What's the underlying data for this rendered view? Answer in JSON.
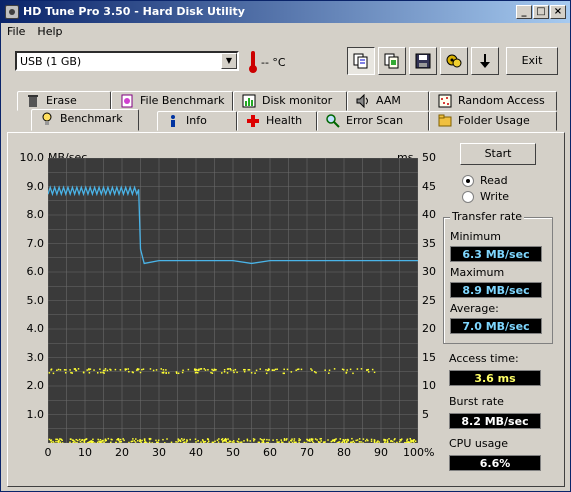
{
  "window": {
    "title": "HD Tune Pro 3.50 - Hard Disk Utility",
    "minimize": "_",
    "maximize": "□",
    "close": "×"
  },
  "menu": {
    "file": "File",
    "help": "Help"
  },
  "toolbar": {
    "drive": "USB (1 GB)",
    "temperature": "-- °C",
    "exit_label": "Exit",
    "icons": [
      "copy-text-icon",
      "copy-screenshot-icon",
      "save-icon",
      "options-icon",
      "download-icon"
    ]
  },
  "tabs_top": [
    "Erase",
    "File Benchmark",
    "Disk monitor",
    "AAM",
    "Random Access"
  ],
  "tabs_bottom": [
    "Benchmark",
    "Info",
    "Health",
    "Error Scan",
    "Folder Usage"
  ],
  "benchmark": {
    "start_label": "Start",
    "read_label": "Read",
    "write_label": "Write",
    "mode": "Read",
    "transfer_rate_title": "Transfer rate",
    "minimum_label": "Minimum",
    "minimum_value": "6.3 MB/sec",
    "maximum_label": "Maximum",
    "maximum_value": "8.9 MB/sec",
    "average_label": "Average:",
    "average_value": "7.0 MB/sec",
    "access_time_label": "Access time:",
    "access_time_value": "3.6 ms",
    "burst_rate_label": "Burst rate",
    "burst_rate_value": "8.2 MB/sec",
    "cpu_usage_label": "CPU usage",
    "cpu_usage_value": "6.6%"
  },
  "chart_data": {
    "type": "line",
    "ylabel_left": "MB/sec",
    "ylabel_right": "ms",
    "ylim_left": [
      0,
      10
    ],
    "ylim_right": [
      0,
      50
    ],
    "xlim": [
      0,
      100
    ],
    "y_ticks_left": [
      "10.0",
      "9.0",
      "8.0",
      "7.0",
      "6.0",
      "5.0",
      "4.0",
      "3.0",
      "2.0",
      "1.0"
    ],
    "y_ticks_right": [
      "50",
      "45",
      "40",
      "35",
      "30",
      "25",
      "20",
      "15",
      "10",
      "5"
    ],
    "x_ticks": [
      "0",
      "10",
      "20",
      "30",
      "40",
      "50",
      "60",
      "70",
      "80",
      "90",
      "100%"
    ],
    "grid": true,
    "series": [
      {
        "color": "#4ab4e8",
        "x": [
          0,
          2,
          5,
          10,
          15,
          20,
          24.5,
          25,
          26,
          30,
          40,
          50,
          55,
          60,
          70,
          80,
          90,
          100
        ],
        "y": [
          8.9,
          8.8,
          8.9,
          8.8,
          8.9,
          8.8,
          8.9,
          6.8,
          6.3,
          6.4,
          6.4,
          6.4,
          6.3,
          6.4,
          6.4,
          6.4,
          6.4,
          6.4
        ]
      }
    ],
    "access_scatter": {
      "color": "#ffff33",
      "bands_ms": [
        13,
        12.5,
        0.5
      ],
      "x_range": [
        0,
        90
      ]
    }
  }
}
